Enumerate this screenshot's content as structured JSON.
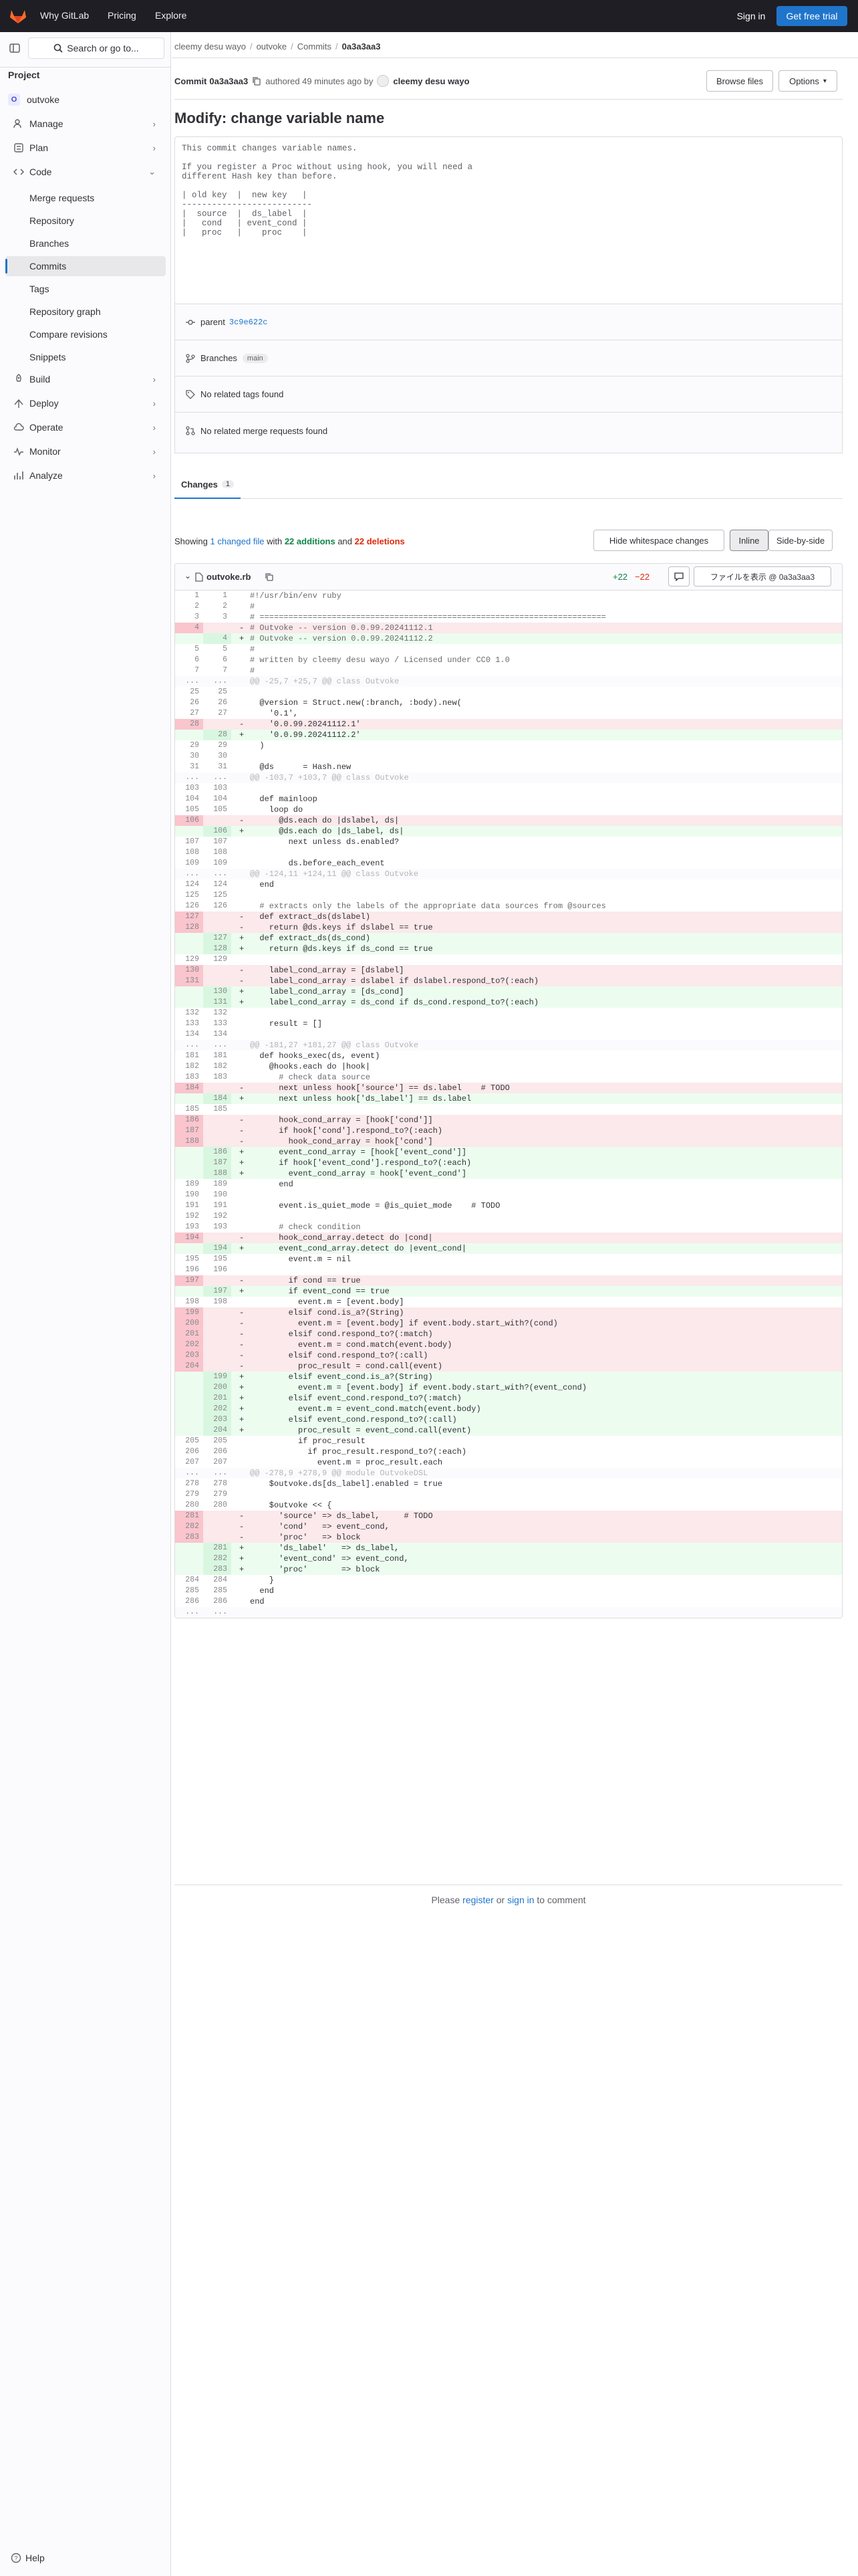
{
  "topbar": {
    "why": "Why GitLab",
    "pricing": "Pricing",
    "explore": "Explore",
    "signin": "Sign in",
    "trial": "Get free trial"
  },
  "search": {
    "label": "Search or go to..."
  },
  "sidebar": {
    "section": "Project",
    "project_initial": "O",
    "project_name": "outvoke",
    "items": [
      "Manage",
      "Plan",
      "Code",
      "Build",
      "Deploy",
      "Operate",
      "Monitor",
      "Analyze"
    ],
    "code_sub": [
      "Merge requests",
      "Repository",
      "Branches",
      "Commits",
      "Tags",
      "Repository graph",
      "Compare revisions",
      "Snippets"
    ],
    "help": "Help"
  },
  "breadcrumb": [
    "cleemy desu wayo",
    "outvoke",
    "Commits",
    "0a3a3aa3"
  ],
  "commit": {
    "prefix": "Commit",
    "sha": "0a3a3aa3",
    "authored": "authored 49 minutes ago by",
    "author": "cleemy desu wayo",
    "browse": "Browse files",
    "options": "Options",
    "title": "Modify: change variable name",
    "description": "This commit changes variable names.\n\nIf you register a Proc without using hook, you will need a\ndifferent Hash key than before.\n\n| old key  |  new key   |\n--------------------------\n|  source  |  ds_label  |\n|   cond   | event_cond |\n|   proc   |    proc    |",
    "parent_label": "parent",
    "parent_sha": "3c9e622c",
    "branches_label": "Branches",
    "branch": "main",
    "no_tags": "No related tags found",
    "no_mrs": "No related merge requests found"
  },
  "changes": {
    "tab": "Changes",
    "count": "1",
    "showing": "Showing",
    "files": "1 changed file",
    "with": "with",
    "additions": "22 additions",
    "and": "and",
    "deletions": "22 deletions",
    "ws": "Hide whitespace changes",
    "inline": "Inline",
    "side": "Side-by-side"
  },
  "file": {
    "name": "outvoke.rb",
    "plus": "+22",
    "minus": "−22",
    "view": "ファイルを表示 @ 0a3a3aa3"
  },
  "diff": [
    [
      "n",
      "1",
      "1",
      "#!/usr/bin/env ruby"
    ],
    [
      "n",
      "2",
      "2",
      "#"
    ],
    [
      "n",
      "3",
      "3",
      "# ========================================================================"
    ],
    [
      "d",
      "4",
      "",
      "# Outvoke -- version 0.0.99.20241112.1"
    ],
    [
      "a",
      "",
      "4",
      "# Outvoke -- version 0.0.99.20241112.2"
    ],
    [
      "n",
      "5",
      "5",
      "#"
    ],
    [
      "n",
      "6",
      "6",
      "# written by cleemy desu wayo / Licensed under CC0 1.0"
    ],
    [
      "n",
      "7",
      "7",
      "#"
    ],
    [
      "h",
      "...",
      "...",
      "@@ -25,7 +25,7 @@ class Outvoke"
    ],
    [
      "n",
      "25",
      "25",
      ""
    ],
    [
      "n",
      "26",
      "26",
      "  @version = Struct.new(:branch, :body).new("
    ],
    [
      "n",
      "27",
      "27",
      "    '0.1',"
    ],
    [
      "d",
      "28",
      "",
      "    '0.0.99.20241112.1'"
    ],
    [
      "a",
      "",
      "28",
      "    '0.0.99.20241112.2'"
    ],
    [
      "n",
      "29",
      "29",
      "  )"
    ],
    [
      "n",
      "30",
      "30",
      ""
    ],
    [
      "n",
      "31",
      "31",
      "  @ds      = Hash.new"
    ],
    [
      "h",
      "...",
      "...",
      "@@ -103,7 +103,7 @@ class Outvoke"
    ],
    [
      "n",
      "103",
      "103",
      ""
    ],
    [
      "n",
      "104",
      "104",
      "  def mainloop"
    ],
    [
      "n",
      "105",
      "105",
      "    loop do"
    ],
    [
      "d",
      "106",
      "",
      "      @ds.each do |dslabel, ds|"
    ],
    [
      "a",
      "",
      "106",
      "      @ds.each do |ds_label, ds|"
    ],
    [
      "n",
      "107",
      "107",
      "        next unless ds.enabled?"
    ],
    [
      "n",
      "108",
      "108",
      ""
    ],
    [
      "n",
      "109",
      "109",
      "        ds.before_each_event"
    ],
    [
      "h",
      "...",
      "...",
      "@@ -124,11 +124,11 @@ class Outvoke"
    ],
    [
      "n",
      "124",
      "124",
      "  end"
    ],
    [
      "n",
      "125",
      "125",
      ""
    ],
    [
      "n",
      "126",
      "126",
      "  # extracts only the labels of the appropriate data sources from @sources"
    ],
    [
      "d",
      "127",
      "",
      "  def extract_ds(dslabel)"
    ],
    [
      "d",
      "128",
      "",
      "    return @ds.keys if dslabel == true"
    ],
    [
      "a",
      "",
      "127",
      "  def extract_ds(ds_cond)"
    ],
    [
      "a",
      "",
      "128",
      "    return @ds.keys if ds_cond == true"
    ],
    [
      "n",
      "129",
      "129",
      ""
    ],
    [
      "d",
      "130",
      "",
      "    label_cond_array = [dslabel]"
    ],
    [
      "d",
      "131",
      "",
      "    label_cond_array = dslabel if dslabel.respond_to?(:each)"
    ],
    [
      "a",
      "",
      "130",
      "    label_cond_array = [ds_cond]"
    ],
    [
      "a",
      "",
      "131",
      "    label_cond_array = ds_cond if ds_cond.respond_to?(:each)"
    ],
    [
      "n",
      "132",
      "132",
      ""
    ],
    [
      "n",
      "133",
      "133",
      "    result = []"
    ],
    [
      "n",
      "134",
      "134",
      ""
    ],
    [
      "h",
      "...",
      "...",
      "@@ -181,27 +181,27 @@ class Outvoke"
    ],
    [
      "n",
      "181",
      "181",
      "  def hooks_exec(ds, event)"
    ],
    [
      "n",
      "182",
      "182",
      "    @hooks.each do |hook|"
    ],
    [
      "n",
      "183",
      "183",
      "      # check data source"
    ],
    [
      "d",
      "184",
      "",
      "      next unless hook['source'] == ds.label    # TODO"
    ],
    [
      "a",
      "",
      "184",
      "      next unless hook['ds_label'] == ds.label"
    ],
    [
      "n",
      "185",
      "185",
      ""
    ],
    [
      "d",
      "186",
      "",
      "      hook_cond_array = [hook['cond']]"
    ],
    [
      "d",
      "187",
      "",
      "      if hook['cond'].respond_to?(:each)"
    ],
    [
      "d",
      "188",
      "",
      "        hook_cond_array = hook['cond']"
    ],
    [
      "a",
      "",
      "186",
      "      event_cond_array = [hook['event_cond']]"
    ],
    [
      "a",
      "",
      "187",
      "      if hook['event_cond'].respond_to?(:each)"
    ],
    [
      "a",
      "",
      "188",
      "        event_cond_array = hook['event_cond']"
    ],
    [
      "n",
      "189",
      "189",
      "      end"
    ],
    [
      "n",
      "190",
      "190",
      ""
    ],
    [
      "n",
      "191",
      "191",
      "      event.is_quiet_mode = @is_quiet_mode    # TODO"
    ],
    [
      "n",
      "192",
      "192",
      ""
    ],
    [
      "n",
      "193",
      "193",
      "      # check condition"
    ],
    [
      "d",
      "194",
      "",
      "      hook_cond_array.detect do |cond|"
    ],
    [
      "a",
      "",
      "194",
      "      event_cond_array.detect do |event_cond|"
    ],
    [
      "n",
      "195",
      "195",
      "        event.m = nil"
    ],
    [
      "n",
      "196",
      "196",
      ""
    ],
    [
      "d",
      "197",
      "",
      "        if cond == true"
    ],
    [
      "a",
      "",
      "197",
      "        if event_cond == true"
    ],
    [
      "n",
      "198",
      "198",
      "          event.m = [event.body]"
    ],
    [
      "d",
      "199",
      "",
      "        elsif cond.is_a?(String)"
    ],
    [
      "d",
      "200",
      "",
      "          event.m = [event.body] if event.body.start_with?(cond)"
    ],
    [
      "d",
      "201",
      "",
      "        elsif cond.respond_to?(:match)"
    ],
    [
      "d",
      "202",
      "",
      "          event.m = cond.match(event.body)"
    ],
    [
      "d",
      "203",
      "",
      "        elsif cond.respond_to?(:call)"
    ],
    [
      "d",
      "204",
      "",
      "          proc_result = cond.call(event)"
    ],
    [
      "a",
      "",
      "199",
      "        elsif event_cond.is_a?(String)"
    ],
    [
      "a",
      "",
      "200",
      "          event.m = [event.body] if event.body.start_with?(event_cond)"
    ],
    [
      "a",
      "",
      "201",
      "        elsif event_cond.respond_to?(:match)"
    ],
    [
      "a",
      "",
      "202",
      "          event.m = event_cond.match(event.body)"
    ],
    [
      "a",
      "",
      "203",
      "        elsif event_cond.respond_to?(:call)"
    ],
    [
      "a",
      "",
      "204",
      "          proc_result = event_cond.call(event)"
    ],
    [
      "n",
      "205",
      "205",
      "          if proc_result"
    ],
    [
      "n",
      "206",
      "206",
      "            if proc_result.respond_to?(:each)"
    ],
    [
      "n",
      "207",
      "207",
      "              event.m = proc_result.each"
    ],
    [
      "h",
      "...",
      "...",
      "@@ -278,9 +278,9 @@ module OutvokeDSL"
    ],
    [
      "n",
      "278",
      "278",
      "    $outvoke.ds[ds_label].enabled = true"
    ],
    [
      "n",
      "279",
      "279",
      ""
    ],
    [
      "n",
      "280",
      "280",
      "    $outvoke << {"
    ],
    [
      "d",
      "281",
      "",
      "      'source' => ds_label,     # TODO"
    ],
    [
      "d",
      "282",
      "",
      "      'cond'   => event_cond,"
    ],
    [
      "d",
      "283",
      "",
      "      'proc'   => block"
    ],
    [
      "a",
      "",
      "281",
      "      'ds_label'   => ds_label,"
    ],
    [
      "a",
      "",
      "282",
      "      'event_cond' => event_cond,"
    ],
    [
      "a",
      "",
      "283",
      "      'proc'       => block"
    ],
    [
      "n",
      "284",
      "284",
      "    }"
    ],
    [
      "n",
      "285",
      "285",
      "  end"
    ],
    [
      "n",
      "286",
      "286",
      "end"
    ],
    [
      "h",
      "...",
      "...",
      ""
    ]
  ],
  "comment": {
    "please": "Please",
    "register": "register",
    "or": "or",
    "signin": "sign in",
    "to": "to comment"
  }
}
